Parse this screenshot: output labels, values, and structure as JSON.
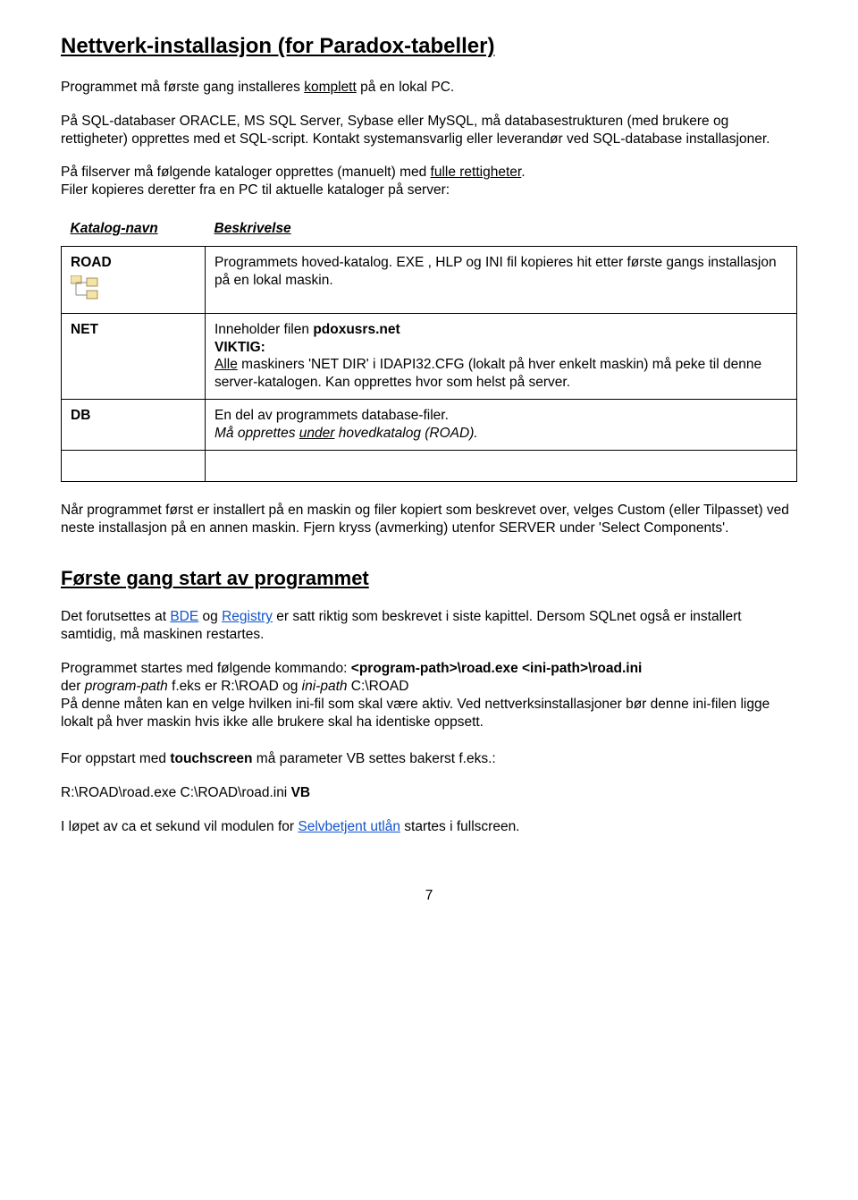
{
  "title": "Nettverk-installasjon (for Paradox-tabeller)",
  "p1a": "Programmet må første gang installeres ",
  "p1b": "komplett",
  "p1c": " på en lokal PC.",
  "p2": "På SQL-databaser ORACLE, MS SQL Server, Sybase eller MySQL, må databasestrukturen (med brukere og rettigheter) opprettes med et SQL-script. Kontakt systemansvarlig eller leverandør ved SQL-database installasjoner.",
  "p3a": "På filserver må følgende kataloger opprettes (manuelt) med ",
  "p3b": "fulle rettigheter",
  "p3c": ".",
  "p4": "Filer kopieres deretter fra en PC til aktuelle kataloger på server:",
  "table": {
    "h1": "Katalog-navn",
    "h2": "Beskrivelse",
    "r1_name": "ROAD",
    "r1_desc": "Programmets hoved-katalog. EXE , HLP og INI fil kopieres hit etter første gangs installasjon på en lokal maskin.",
    "r2_name": "NET",
    "r2_desc_a": "Inneholder filen ",
    "r2_desc_b": "pdoxusrs.net",
    "r2_desc_c": "VIKTIG:",
    "r2_desc_d": "Alle",
    "r2_desc_e": " maskiners 'NET DIR' i IDAPI32.CFG (lokalt på hver enkelt maskin) må peke til denne server-katalogen. Kan opprettes hvor som helst på server.",
    "r3_name": "DB",
    "r3_desc_a": "En del av programmets database-filer.",
    "r3_desc_b": "Må opprettes ",
    "r3_desc_c": "under",
    "r3_desc_d": " hovedkatalog (ROAD)."
  },
  "p5": "Når programmet først er installert på en maskin og filer kopiert som beskrevet over, velges Custom (eller Tilpasset)  ved neste installasjon på en annen maskin. Fjern kryss (avmerking) utenfor SERVER under 'Select Components'.",
  "section2": "Første gang start av programmet",
  "p6a": "Det forutsettes at ",
  "p6b": "BDE",
  "p6c": " og ",
  "p6d": "Registry",
  "p6e": " er satt riktig som beskrevet i siste kapittel. Dersom SQLnet også er installert samtidig, må maskinen restartes.",
  "p7a": "Programmet startes med følgende kommando: ",
  "p7b": "<program-path>\\road.exe  <ini-path>\\road.ini",
  "p8a": "der ",
  "p8b": "program-path",
  "p8c": " f.eks er R:\\ROAD og ",
  "p8d": "ini-path",
  "p8e": " C:\\ROAD",
  "p9": "På denne måten kan en velge hvilken ini-fil som skal være aktiv. Ved nettverksinstallasjoner bør denne ini-filen ligge lokalt på hver maskin hvis ikke alle brukere skal ha identiske oppsett.",
  "p10a": "For oppstart med ",
  "p10b": "touchscreen",
  "p10c": " må parameter VB settes bakerst f.eks.:",
  "p11a": "R:\\ROAD\\road.exe  C:\\ROAD\\road.ini ",
  "p11b": "VB",
  "p12a": "I løpet av ca et sekund vil modulen for ",
  "p12b": "Selvbetjent utlån",
  "p12c": " startes i fullscreen.",
  "pageNumber": "7"
}
